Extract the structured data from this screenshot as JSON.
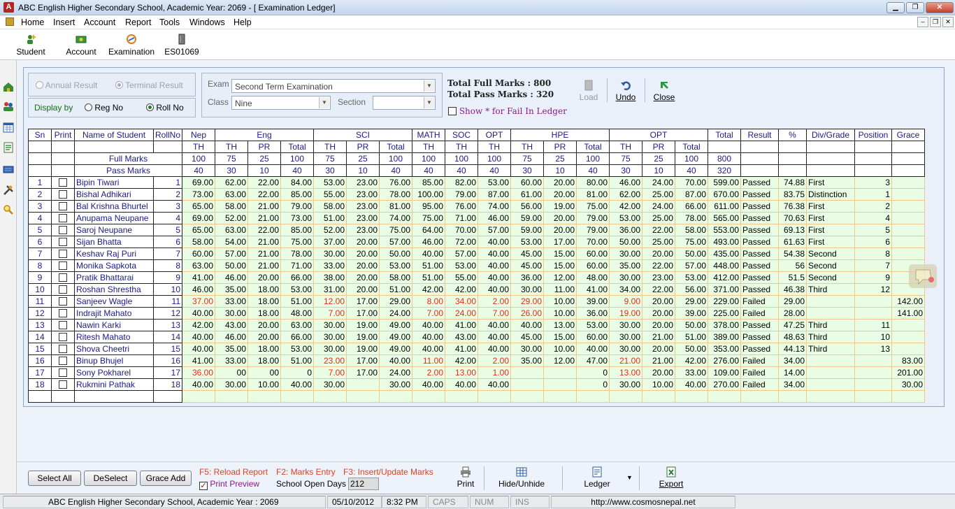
{
  "window": {
    "title": "ABC English Higher Secondary School, Academic Year: 2069 - [ Examination Ledger]"
  },
  "menu": [
    "Home",
    "Insert",
    "Account",
    "Report",
    "Tools",
    "Windows",
    "Help"
  ],
  "toolbar": [
    {
      "label": "Student",
      "icon": "student-icon"
    },
    {
      "label": "Account",
      "icon": "account-icon"
    },
    {
      "label": "Examination",
      "icon": "examination-icon"
    },
    {
      "label": "ES01069",
      "icon": "book-icon"
    }
  ],
  "result_type": {
    "annual": "Annual Result",
    "terminal": "Terminal Result",
    "selected": "terminal"
  },
  "display_by": {
    "label": "Display by",
    "reg": "Reg No",
    "roll": "Roll No",
    "selected": "roll"
  },
  "filters": {
    "exam_label": "Exam",
    "exam_value": "Second Term Examination",
    "class_label": "Class",
    "class_value": "Nine",
    "section_label": "Section",
    "section_value": ""
  },
  "totals": {
    "full": "Total Full Marks : 800",
    "pass": "Total Pass Marks : 320",
    "show_fail": "Show * for Fail In Ledger"
  },
  "actions": {
    "load": "Load",
    "undo": "Undo",
    "close": "Close"
  },
  "ledger": {
    "group_headers": [
      "Sn",
      "Print",
      "Name of Student",
      "RollNo",
      "Nep",
      "Eng",
      "SCI",
      "MATH",
      "SOC",
      "OPT",
      "HPE",
      "OPT",
      "Total",
      "Result",
      "%",
      "Div/Grade",
      "Position",
      "Grace"
    ],
    "sub_headers": [
      "TH",
      "TH",
      "PR",
      "Total",
      "TH",
      "PR",
      "Total",
      "TH",
      "TH",
      "TH",
      "TH",
      "PR",
      "Total",
      "TH",
      "PR",
      "Total"
    ],
    "full_marks_label": "Full Marks",
    "full_marks": [
      "100",
      "75",
      "25",
      "100",
      "75",
      "25",
      "100",
      "100",
      "100",
      "100",
      "75",
      "25",
      "100",
      "75",
      "25",
      "100",
      "800"
    ],
    "pass_marks_label": "Pass Marks",
    "pass_marks": [
      "40",
      "30",
      "10",
      "40",
      "30",
      "10",
      "40",
      "40",
      "40",
      "40",
      "30",
      "10",
      "40",
      "30",
      "10",
      "40",
      "320"
    ],
    "rows": [
      {
        "sn": "1",
        "name": "Bipin  Tiwari",
        "roll": "1",
        "marks": [
          "69.00",
          "62.00",
          "22.00",
          "84.00",
          "53.00",
          "23.00",
          "76.00",
          "85.00",
          "82.00",
          "53.00",
          "60.00",
          "20.00",
          "80.00",
          "46.00",
          "24.00",
          "70.00",
          "599.00"
        ],
        "red": [],
        "result": "Passed",
        "pct": "74.88",
        "div": "First",
        "pos": "3",
        "grace": ""
      },
      {
        "sn": "2",
        "name": "Bishal  Adhikari",
        "roll": "2",
        "marks": [
          "73.00",
          "63.00",
          "22.00",
          "85.00",
          "55.00",
          "23.00",
          "78.00",
          "100.00",
          "79.00",
          "87.00",
          "61.00",
          "20.00",
          "81.00",
          "62.00",
          "25.00",
          "87.00",
          "670.00"
        ],
        "red": [],
        "result": "Passed",
        "pct": "83.75",
        "div": "Distinction",
        "pos": "1",
        "grace": ""
      },
      {
        "sn": "3",
        "name": "Bal Krishna Bhurtel",
        "roll": "3",
        "marks": [
          "65.00",
          "58.00",
          "21.00",
          "79.00",
          "58.00",
          "23.00",
          "81.00",
          "95.00",
          "76.00",
          "74.00",
          "56.00",
          "19.00",
          "75.00",
          "42.00",
          "24.00",
          "66.00",
          "611.00"
        ],
        "red": [],
        "result": "Passed",
        "pct": "76.38",
        "div": "First",
        "pos": "2",
        "grace": ""
      },
      {
        "sn": "4",
        "name": "Anupama  Neupane",
        "roll": "4",
        "marks": [
          "69.00",
          "52.00",
          "21.00",
          "73.00",
          "51.00",
          "23.00",
          "74.00",
          "75.00",
          "71.00",
          "46.00",
          "59.00",
          "20.00",
          "79.00",
          "53.00",
          "25.00",
          "78.00",
          "565.00"
        ],
        "red": [],
        "result": "Passed",
        "pct": "70.63",
        "div": "First",
        "pos": "4",
        "grace": ""
      },
      {
        "sn": "5",
        "name": "Saroj  Neupane",
        "roll": "5",
        "marks": [
          "65.00",
          "63.00",
          "22.00",
          "85.00",
          "52.00",
          "23.00",
          "75.00",
          "64.00",
          "70.00",
          "57.00",
          "59.00",
          "20.00",
          "79.00",
          "36.00",
          "22.00",
          "58.00",
          "553.00"
        ],
        "red": [],
        "result": "Passed",
        "pct": "69.13",
        "div": "First",
        "pos": "5",
        "grace": ""
      },
      {
        "sn": "6",
        "name": "Sijan  Bhatta",
        "roll": "6",
        "marks": [
          "58.00",
          "54.00",
          "21.00",
          "75.00",
          "37.00",
          "20.00",
          "57.00",
          "46.00",
          "72.00",
          "40.00",
          "53.00",
          "17.00",
          "70.00",
          "50.00",
          "25.00",
          "75.00",
          "493.00"
        ],
        "red": [],
        "result": "Passed",
        "pct": "61.63",
        "div": "First",
        "pos": "6",
        "grace": ""
      },
      {
        "sn": "7",
        "name": "Keshav Raj Puri",
        "roll": "7",
        "marks": [
          "60.00",
          "57.00",
          "21.00",
          "78.00",
          "30.00",
          "20.00",
          "50.00",
          "40.00",
          "57.00",
          "40.00",
          "45.00",
          "15.00",
          "60.00",
          "30.00",
          "20.00",
          "50.00",
          "435.00"
        ],
        "red": [],
        "result": "Passed",
        "pct": "54.38",
        "div": "Second",
        "pos": "8",
        "grace": ""
      },
      {
        "sn": "8",
        "name": "Monika  Sapkota",
        "roll": "8",
        "marks": [
          "63.00",
          "50.00",
          "21.00",
          "71.00",
          "33.00",
          "20.00",
          "53.00",
          "51.00",
          "53.00",
          "40.00",
          "45.00",
          "15.00",
          "60.00",
          "35.00",
          "22.00",
          "57.00",
          "448.00"
        ],
        "red": [],
        "result": "Passed",
        "pct": "56",
        "div": "Second",
        "pos": "7",
        "grace": ""
      },
      {
        "sn": "9",
        "name": "Pratik  Bhattarai",
        "roll": "9",
        "marks": [
          "41.00",
          "46.00",
          "20.00",
          "66.00",
          "38.00",
          "20.00",
          "58.00",
          "51.00",
          "55.00",
          "40.00",
          "36.00",
          "12.00",
          "48.00",
          "30.00",
          "23.00",
          "53.00",
          "412.00"
        ],
        "red": [],
        "result": "Passed",
        "pct": "51.5",
        "div": "Second",
        "pos": "9",
        "grace": ""
      },
      {
        "sn": "10",
        "name": "Roshan  Shrestha",
        "roll": "10",
        "marks": [
          "46.00",
          "35.00",
          "18.00",
          "53.00",
          "31.00",
          "20.00",
          "51.00",
          "42.00",
          "42.00",
          "40.00",
          "30.00",
          "11.00",
          "41.00",
          "34.00",
          "22.00",
          "56.00",
          "371.00"
        ],
        "red": [],
        "result": "Passed",
        "pct": "46.38",
        "div": "Third",
        "pos": "12",
        "grace": ""
      },
      {
        "sn": "11",
        "name": "Sanjeev  Wagle",
        "roll": "11",
        "marks": [
          "37.00",
          "33.00",
          "18.00",
          "51.00",
          "12.00",
          "17.00",
          "29.00",
          "8.00",
          "34.00",
          "2.00",
          "29.00",
          "10.00",
          "39.00",
          "9.00",
          "20.00",
          "29.00",
          "229.00"
        ],
        "red": [
          0,
          4,
          7,
          8,
          9,
          10,
          13
        ],
        "result": "Failed",
        "pct": "29.00",
        "div": "",
        "pos": "",
        "grace": "142.00"
      },
      {
        "sn": "12",
        "name": "Indrajit  Mahato",
        "roll": "12",
        "marks": [
          "40.00",
          "30.00",
          "18.00",
          "48.00",
          "7.00",
          "17.00",
          "24.00",
          "7.00",
          "24.00",
          "7.00",
          "26.00",
          "10.00",
          "36.00",
          "19.00",
          "20.00",
          "39.00",
          "225.00"
        ],
        "red": [
          4,
          7,
          8,
          9,
          10,
          13
        ],
        "result": "Failed",
        "pct": "28.00",
        "div": "",
        "pos": "",
        "grace": "141.00"
      },
      {
        "sn": "13",
        "name": "Nawin  Karki",
        "roll": "13",
        "marks": [
          "42.00",
          "43.00",
          "20.00",
          "63.00",
          "30.00",
          "19.00",
          "49.00",
          "40.00",
          "41.00",
          "40.00",
          "40.00",
          "13.00",
          "53.00",
          "30.00",
          "20.00",
          "50.00",
          "378.00"
        ],
        "red": [],
        "result": "Passed",
        "pct": "47.25",
        "div": "Third",
        "pos": "11",
        "grace": ""
      },
      {
        "sn": "14",
        "name": "Ritesh  Mahato",
        "roll": "14",
        "marks": [
          "40.00",
          "46.00",
          "20.00",
          "66.00",
          "30.00",
          "19.00",
          "49.00",
          "40.00",
          "43.00",
          "40.00",
          "45.00",
          "15.00",
          "60.00",
          "30.00",
          "21.00",
          "51.00",
          "389.00"
        ],
        "red": [],
        "result": "Passed",
        "pct": "48.63",
        "div": "Third",
        "pos": "10",
        "grace": ""
      },
      {
        "sn": "15",
        "name": "Shova  Cheetri",
        "roll": "15",
        "marks": [
          "40.00",
          "35.00",
          "18.00",
          "53.00",
          "30.00",
          "19.00",
          "49.00",
          "40.00",
          "41.00",
          "40.00",
          "30.00",
          "10.00",
          "40.00",
          "30.00",
          "20.00",
          "50.00",
          "353.00"
        ],
        "red": [],
        "result": "Passed",
        "pct": "44.13",
        "div": "Third",
        "pos": "13",
        "grace": ""
      },
      {
        "sn": "16",
        "name": "Binup  Bhujel",
        "roll": "16",
        "marks": [
          "41.00",
          "33.00",
          "18.00",
          "51.00",
          "23.00",
          "17.00",
          "40.00",
          "11.00",
          "42.00",
          "2.00",
          "35.00",
          "12.00",
          "47.00",
          "21.00",
          "21.00",
          "42.00",
          "276.00"
        ],
        "red": [
          4,
          7,
          9,
          13
        ],
        "result": "Failed",
        "pct": "34.00",
        "div": "",
        "pos": "",
        "grace": "83.00"
      },
      {
        "sn": "17",
        "name": "Sony  Pokharel",
        "roll": "17",
        "marks": [
          "36.00",
          "00",
          "00",
          "0",
          "7.00",
          "17.00",
          "24.00",
          "2.00",
          "13.00",
          "1.00",
          "",
          "",
          "0",
          "13.00",
          "20.00",
          "33.00",
          "109.00"
        ],
        "red": [
          0,
          4,
          7,
          8,
          9,
          13
        ],
        "result": "Failed",
        "pct": "14.00",
        "div": "",
        "pos": "",
        "grace": "201.00"
      },
      {
        "sn": "18",
        "name": "Rukmini  Pathak",
        "roll": "18",
        "marks": [
          "40.00",
          "30.00",
          "10.00",
          "40.00",
          "30.00",
          "",
          "30.00",
          "40.00",
          "40.00",
          "40.00",
          "",
          "",
          "0",
          "30.00",
          "10.00",
          "40.00",
          "270.00"
        ],
        "red": [],
        "result": "Failed",
        "pct": "34.00",
        "div": "",
        "pos": "",
        "grace": "30.00"
      }
    ]
  },
  "bottom": {
    "select_all": "Select All",
    "deselect": "DeSelect",
    "grace_add": "Grace Add",
    "f5": "F5: Reload Report",
    "f2": "F2: Marks Entry",
    "f3": "F3: Insert/Update Marks",
    "print_preview": "Print Preview",
    "open_days_label": "School Open Days",
    "open_days": "212",
    "print": "Print",
    "hide": "Hide/Unhide",
    "ledger": "Ledger",
    "export": "Export"
  },
  "status": {
    "school": "ABC English Higher Secondary School, Academic Year : 2069",
    "date": "05/10/2012",
    "time": "8:32 PM",
    "caps": "CAPS",
    "num": "NUM",
    "ins": "INS",
    "url": "http://www.cosmosnepal.net"
  },
  "colors": {
    "accent": "#1a1a8a",
    "fail": "#e82a1a",
    "row_bg": "#e9fde5",
    "grid": "#f0c68a",
    "frame": "#e5edf8",
    "group_green": "#1a6a1a",
    "purple": "#8a1a8a"
  }
}
